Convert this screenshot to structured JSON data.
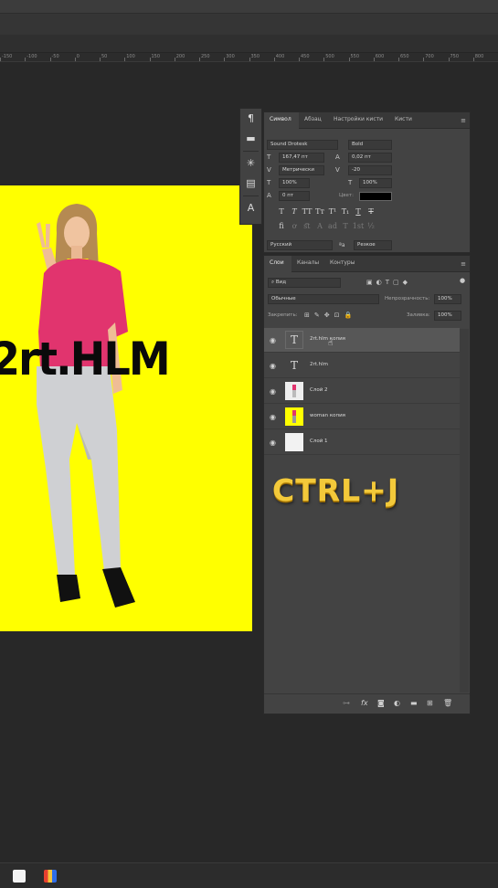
{
  "ruler": {
    "ticks": [
      "-150",
      "-100",
      "-50",
      "0",
      "50",
      "100",
      "150",
      "200",
      "250",
      "300",
      "350",
      "400",
      "450",
      "500",
      "550",
      "600",
      "650",
      "700",
      "750",
      "800"
    ]
  },
  "canvas": {
    "text": "2rt.HLM",
    "background": "#ffff00"
  },
  "character_panel": {
    "tabs": [
      "Символ",
      "Абзац",
      "Настройки кисти",
      "Кисти"
    ],
    "font_family": "Sound Drotesk",
    "font_style": "Bold",
    "font_size": "167,47 пт",
    "leading": "0,02 пт",
    "kerning": "Метрически",
    "tracking": "-20",
    "vertical_scale": "100%",
    "horizontal_scale": "100%",
    "baseline_shift": "0 пт",
    "color_label": "Цвет:",
    "color": "#000000",
    "language": "Русский",
    "antialias": "Резкое"
  },
  "layers_panel": {
    "tabs": [
      "Слои",
      "Каналы",
      "Контуры"
    ],
    "filter_placeholder": "Вид",
    "blend_mode": "Обычные",
    "opacity_label": "Непрозрачность:",
    "opacity": "100%",
    "lock_label": "Закрепить:",
    "fill_label": "Заливка:",
    "fill": "100%",
    "layers": [
      {
        "name": "2rt.hlm копия",
        "type": "text",
        "selected": true
      },
      {
        "name": "2rt.hlm",
        "type": "text",
        "selected": false
      },
      {
        "name": "Слой 2",
        "type": "pixel-person",
        "selected": false
      },
      {
        "name": "woman копия",
        "type": "pixel-yellow",
        "selected": false
      },
      {
        "name": "Слой 1",
        "type": "pixel-white",
        "selected": false
      }
    ]
  },
  "overlay": {
    "shortcut": "CTRL+J"
  },
  "colors": {
    "accent_gold": "#f3c93a",
    "canvas_yellow": "#ffff00",
    "panel_bg": "#434343"
  }
}
